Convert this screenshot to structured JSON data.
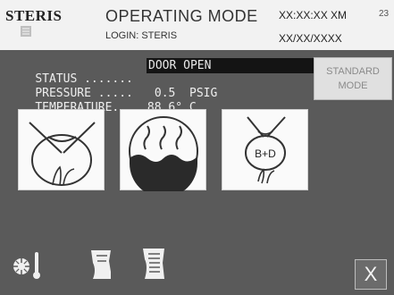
{
  "header": {
    "brand": "STERIS",
    "mode_title": "OPERATING MODE",
    "login": "LOGIN: STERIS",
    "time": "XX:XX:XX XM",
    "date": "XX/XX/XXXX",
    "unit_id": "23"
  },
  "status": {
    "status_label": "STATUS .......",
    "status_value": "DOOR OPEN",
    "pressure_label": "PRESSURE .....",
    "pressure_value": "0.5  PSIG",
    "temperature_label": "TEMPERATURE...",
    "temperature_value": "88.6° C"
  },
  "standard_mode": {
    "line1": "STANDARD",
    "line2": "MODE"
  },
  "cycles": [
    {
      "icon": "gravity-cycle-icon"
    },
    {
      "icon": "prevac-steam-cycle-icon"
    },
    {
      "icon": "bowie-dick-test-icon",
      "label": "B+D"
    }
  ],
  "toolbar": {
    "items": [
      "temperature-gauge-icon",
      "print-receipt-icon",
      "print-report-icon"
    ]
  },
  "close_label": "X",
  "colors": {
    "header_bg": "#f2f2f2",
    "screen_bg": "#5a5a5a",
    "status_value_bg": "#141414"
  }
}
